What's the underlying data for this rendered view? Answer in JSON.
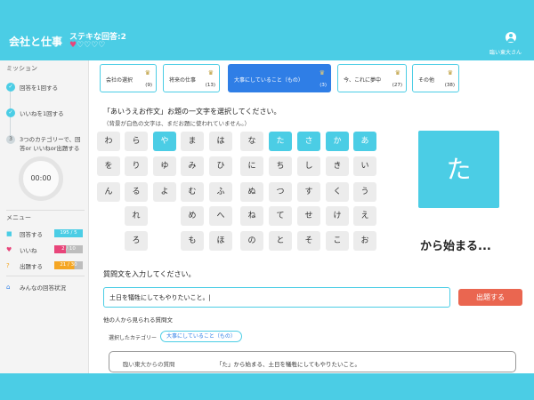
{
  "header": {
    "app_title": "会社と仕事",
    "sub_title": "ステキな回答:2",
    "hearts_filled": "♥",
    "hearts_empty": "♡♡♡♡",
    "user_name": "臨い東大さん"
  },
  "sidebar": {
    "mission_heading": "ミッション",
    "missions": [
      {
        "check": "✓",
        "label": "回答を1回する"
      },
      {
        "check": "✓",
        "label": "いいねを1回する"
      },
      {
        "check": "3",
        "label": "3つのカテゴリーで、回答or いいねor出題する"
      }
    ],
    "timer": "00:00",
    "menu_heading": "メニュー",
    "menu": [
      {
        "icon": "■",
        "label": "回答する",
        "badge": "195 / 5",
        "color": "#4bcde5"
      },
      {
        "icon": "♥",
        "label": "いいね",
        "badge": "2 / 10",
        "color": "#e8457a"
      },
      {
        "icon": "?",
        "label": "出題する",
        "badge": "21 / 30",
        "color": "#f5a623"
      }
    ],
    "all_answers": {
      "icon": "⌂",
      "label": "みんなの回答状況"
    }
  },
  "categories": [
    {
      "label": "会社の選択",
      "count": "(9)",
      "icon": "♛"
    },
    {
      "label": "将来の仕事",
      "count": "(13)",
      "icon": "♛"
    },
    {
      "label": "大事にしていること（もの）",
      "count": "(3)",
      "icon": "♛"
    },
    {
      "label": "今、これに夢中",
      "count": "(27)",
      "icon": "♛"
    },
    {
      "label": "その他",
      "count": "(38)",
      "icon": "♛"
    }
  ],
  "instruction": "「あいうえお作文」お題の一文字を選択してください。",
  "instruction_note": "（背景が白色の文字は、まだお題に使われていません。）",
  "kana_rows": [
    [
      "わ",
      "ら",
      "や",
      "ま",
      "は",
      "な",
      "た",
      "さ",
      "か",
      "あ"
    ],
    [
      "を",
      "り",
      "ゆ",
      "み",
      "ひ",
      "に",
      "ち",
      "し",
      "き",
      "い"
    ],
    [
      "ん",
      "る",
      "よ",
      "む",
      "ふ",
      "ぬ",
      "つ",
      "す",
      "く",
      "う"
    ],
    [
      "",
      "れ",
      "",
      "め",
      "へ",
      "ね",
      "て",
      "せ",
      "け",
      "え"
    ],
    [
      "",
      "ろ",
      "",
      "も",
      "ほ",
      "の",
      "と",
      "そ",
      "こ",
      "お"
    ]
  ],
  "selected_char": "た",
  "starts_with": "から始まる...",
  "question_label": "質問文を入力してください。",
  "question_value": "土日を犠牲にしてもやりたいこと。|",
  "submit_label": "出題する",
  "others_label": "他の人から見られる質問文",
  "selected_category_label": "選択したカテゴリー",
  "selected_category_value": "大事にしていること（もの）",
  "preview": {
    "from": "臨い東大からの質問",
    "text": "「た」から始まる、土日を犠牲にしてもやりたいこと。"
  },
  "colors": {
    "accent": "#4bcde5",
    "active_tab": "#2f7ee6",
    "submit": "#ea6650"
  }
}
